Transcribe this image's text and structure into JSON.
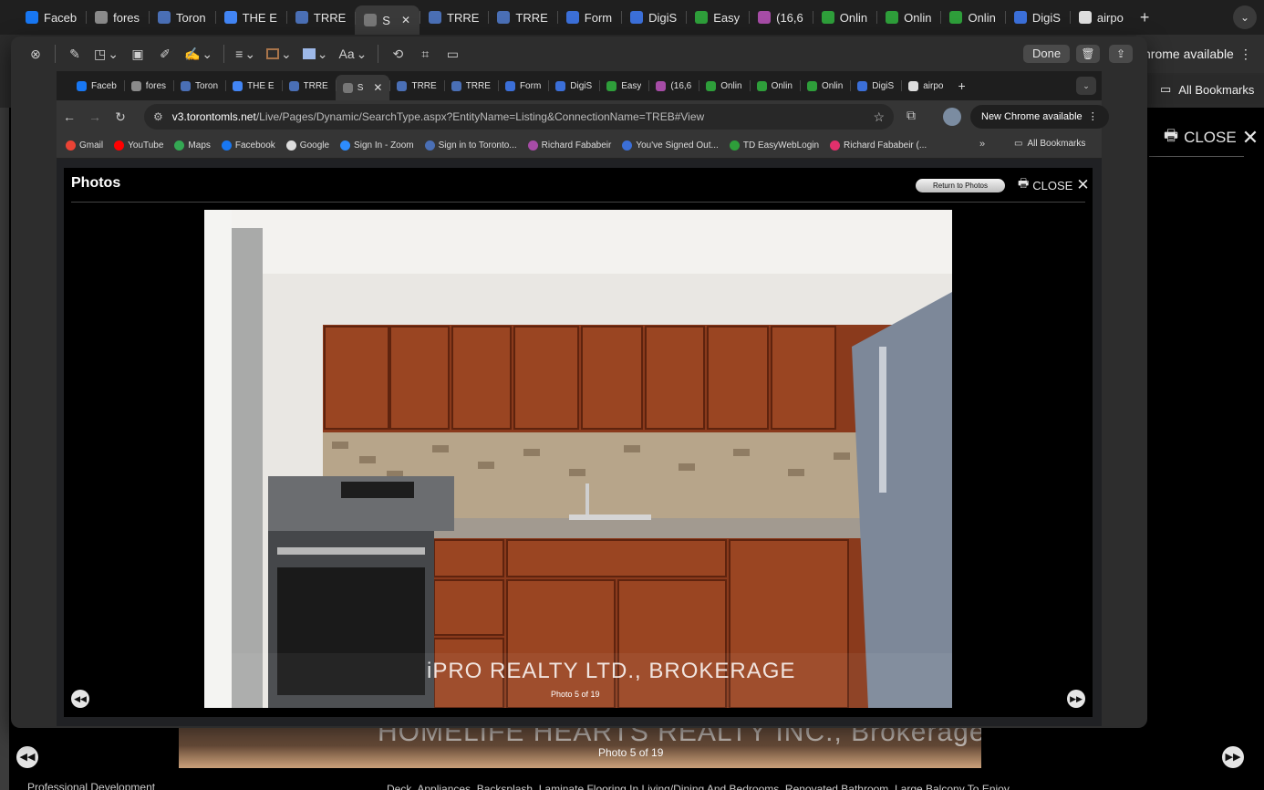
{
  "outer_tabs": [
    {
      "label": "Faceb",
      "icon": "facebook-icon",
      "color": "#1877f2"
    },
    {
      "label": "fores",
      "icon": "info-icon",
      "color": "#8a8a8a"
    },
    {
      "label": "Toron",
      "icon": "trreb-icon",
      "color": "#4a6fb5"
    },
    {
      "label": "THE E",
      "icon": "docs-icon",
      "color": "#4285f4"
    },
    {
      "label": "TRRE",
      "icon": "trreb-icon",
      "color": "#4a6fb5"
    },
    {
      "label": "S",
      "icon": "site-icon",
      "color": "#777777",
      "active": true
    },
    {
      "label": "TRRE",
      "icon": "trreb-icon",
      "color": "#4a6fb5"
    },
    {
      "label": "TRRE",
      "icon": "trreb-icon",
      "color": "#4a6fb5"
    },
    {
      "label": "Form",
      "icon": "digisign-icon",
      "color": "#3b6fd8"
    },
    {
      "label": "DigiS",
      "icon": "digisign-icon",
      "color": "#3b6fd8"
    },
    {
      "label": "Easy",
      "icon": "td-icon",
      "color": "#2e9e3a"
    },
    {
      "label": "(16,6",
      "icon": "chat-icon",
      "color": "#a64ca6"
    },
    {
      "label": "Onlin",
      "icon": "td-icon",
      "color": "#2e9e3a"
    },
    {
      "label": "Onlin",
      "icon": "td-icon",
      "color": "#2e9e3a"
    },
    {
      "label": "Onlin",
      "icon": "td-icon",
      "color": "#2e9e3a"
    },
    {
      "label": "DigiS",
      "icon": "digisign-icon",
      "color": "#3b6fd8"
    },
    {
      "label": "airpo",
      "icon": "google-icon",
      "color": "#dddddd"
    }
  ],
  "outer": {
    "new_chrome": "hrome available",
    "all_bookmarks": "All Bookmarks",
    "close_label": "CLOSE",
    "watermark": "HOMELIFE HEARTS REALTY INC., Brokerage",
    "caption": "Photo 5 of 19",
    "bottom_text": "Deck, Appliances, Backsplash, Laminate Flooring In Living/Dining And Bedrooms, Renovated Bathroom, Large Balcony To Enjoy",
    "bottom_left": "Professional Development"
  },
  "markup": {
    "done_label": "Done"
  },
  "inner_tabs": [
    {
      "label": "Faceb",
      "color": "#1877f2"
    },
    {
      "label": "fores",
      "color": "#8a8a8a"
    },
    {
      "label": "Toron",
      "color": "#4a6fb5"
    },
    {
      "label": "THE E",
      "color": "#4285f4"
    },
    {
      "label": "TRRE",
      "color": "#4a6fb5"
    },
    {
      "label": "S",
      "color": "#777777",
      "active": true
    },
    {
      "label": "TRRE",
      "color": "#4a6fb5"
    },
    {
      "label": "TRRE",
      "color": "#4a6fb5"
    },
    {
      "label": "Form",
      "color": "#3b6fd8"
    },
    {
      "label": "DigiS",
      "color": "#3b6fd8"
    },
    {
      "label": "Easy",
      "color": "#2e9e3a"
    },
    {
      "label": "(16,6",
      "color": "#a64ca6"
    },
    {
      "label": "Onlin",
      "color": "#2e9e3a"
    },
    {
      "label": "Onlin",
      "color": "#2e9e3a"
    },
    {
      "label": "Onlin",
      "color": "#2e9e3a"
    },
    {
      "label": "DigiS",
      "color": "#3b6fd8"
    },
    {
      "label": "airpo",
      "color": "#dddddd"
    }
  ],
  "inner": {
    "url_host": "v3.torontomls.net",
    "url_path": "/Live/Pages/Dynamic/SearchType.aspx?EntityName=Listing&ConnectionName=TREB#View",
    "new_chrome": "New Chrome available",
    "all_bookmarks": "All Bookmarks",
    "bookmarks": [
      {
        "label": "Gmail",
        "color": "#ea4335"
      },
      {
        "label": "YouTube",
        "color": "#ff0000"
      },
      {
        "label": "Maps",
        "color": "#34a853"
      },
      {
        "label": "Facebook",
        "color": "#1877f2"
      },
      {
        "label": "Google",
        "color": "#dddddd"
      },
      {
        "label": "Sign In - Zoom",
        "color": "#2d8cff"
      },
      {
        "label": "Sign in to Toronto...",
        "color": "#4a6fb5"
      },
      {
        "label": "Richard Fababeir",
        "color": "#a64ca6"
      },
      {
        "label": "You've Signed Out...",
        "color": "#3b6fd8"
      },
      {
        "label": "TD EasyWebLogin",
        "color": "#2e9e3a"
      },
      {
        "label": "Richard Fababeir (...",
        "color": "#e1306c"
      }
    ]
  },
  "modal": {
    "title": "Photos",
    "return_label": "Return to Photos",
    "close_label": "CLOSE",
    "watermark": "iPRO REALTY LTD., BROKERAGE",
    "caption": "Photo 5 of 19"
  }
}
